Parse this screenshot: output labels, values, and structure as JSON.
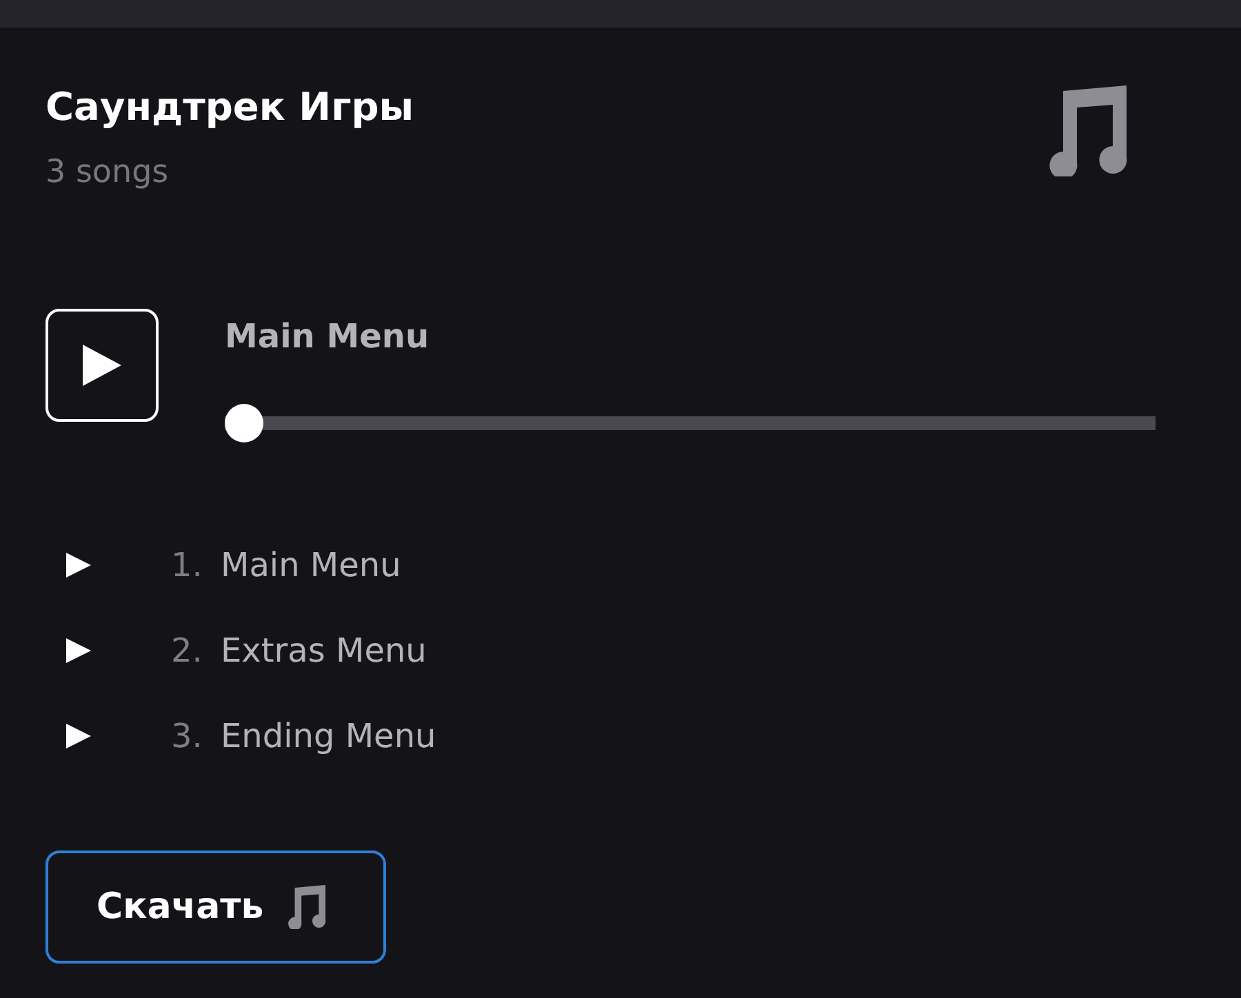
{
  "album": {
    "title": "Саундтрек Игры",
    "subtitle": "3 songs"
  },
  "player": {
    "current_title": "Main Menu",
    "progress": {
      "level": 0
    }
  },
  "tracks": [
    {
      "number": "1.",
      "title": "Main Menu"
    },
    {
      "number": "2.",
      "title": "Extras Menu"
    },
    {
      "number": "3.",
      "title": "Ending Menu"
    }
  ],
  "download_button": {
    "label": "Скачать"
  }
}
